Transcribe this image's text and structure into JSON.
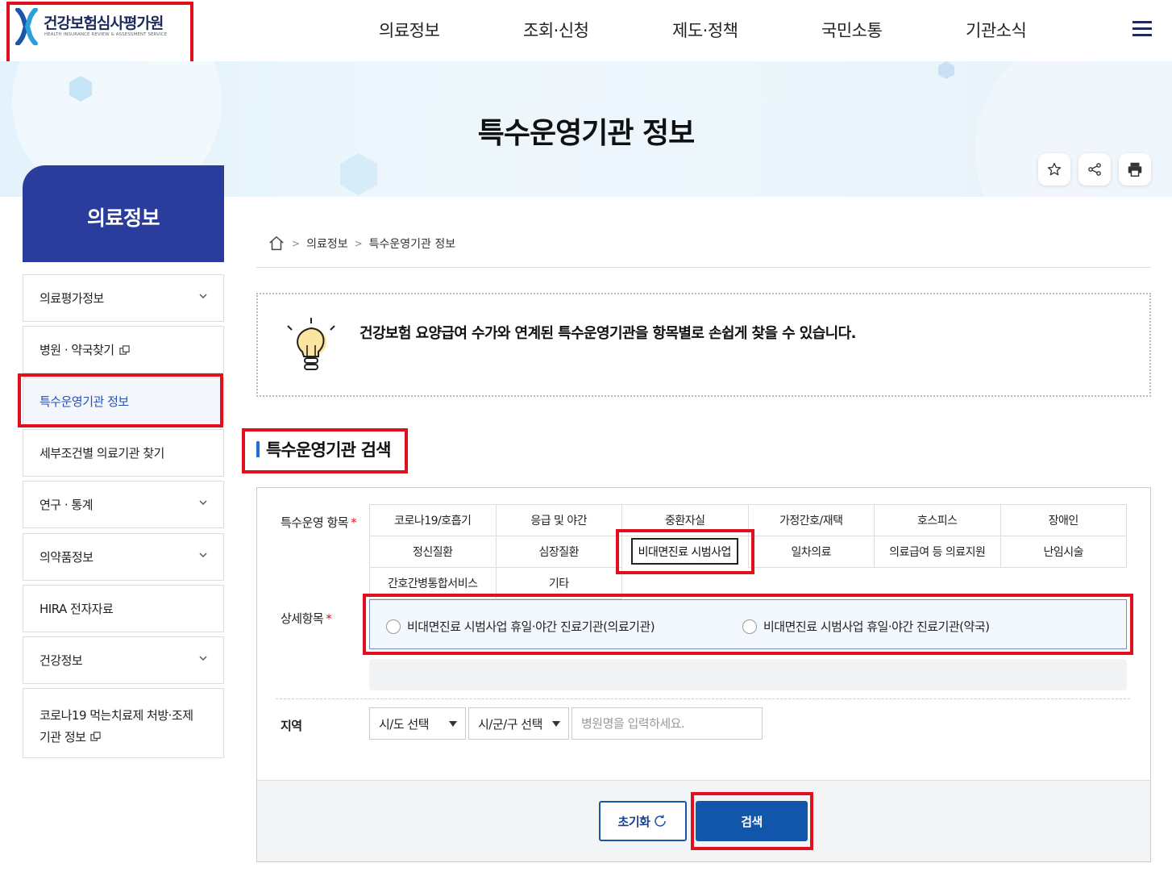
{
  "header": {
    "logo_ko": "건강보험심사평가원",
    "logo_en": "HEALTH INSURANCE REVIEW & ASSESSMENT SERVICE",
    "nav": [
      "의료정보",
      "조회·신청",
      "제도·정책",
      "국민소통",
      "기관소식"
    ],
    "menu_icon": "hamburger-icon"
  },
  "hero": {
    "title": "특수운영기관 정보",
    "utility_icons": [
      "star-icon",
      "share-icon",
      "print-icon"
    ]
  },
  "sidebar": {
    "title": "의료정보",
    "items": [
      {
        "label": "의료평가정보",
        "icon": "chevron-down-icon"
      },
      {
        "label": "병원 · 약국찾기",
        "icon": "external-link-icon"
      },
      {
        "label": "특수운영기관 정보",
        "active": true
      },
      {
        "label": "세부조건별 의료기관 찾기"
      },
      {
        "label": "연구 · 통계",
        "icon": "chevron-down-icon"
      },
      {
        "label": "의약품정보",
        "icon": "chevron-down-icon"
      },
      {
        "label": "HIRA 전자자료"
      },
      {
        "label": "건강정보",
        "icon": "chevron-down-icon"
      },
      {
        "label_line1": "코로나19 먹는치료제 처방·조제",
        "label_line2": "기관 정보",
        "icon": "external-link-icon"
      }
    ]
  },
  "breadcrumb": {
    "home_icon": "home-icon",
    "items": [
      "의료정보",
      "특수운영기관 정보"
    ]
  },
  "info": {
    "icon": "lightbulb-icon",
    "text": "건강보험 요양급여 수가와 연계된 특수운영기관을 항목별로 손쉽게 찾을 수 있습니다."
  },
  "search": {
    "section_title": "특수운영기관 검색",
    "category_label": "특수운영 항목",
    "required_mark": "*",
    "categories": [
      "코로나19/호흡기",
      "응급 및 야간",
      "중환자실",
      "가정간호/재택",
      "호스피스",
      "장애인",
      "정신질환",
      "심장질환",
      "비대면진료 시범사업",
      "일차의료",
      "의료급여 등 의료지원",
      "난임시술",
      "간호간병통합서비스",
      "기타"
    ],
    "selected_category": "비대면진료 시범사업",
    "detail_label": "상세항목",
    "detail_options": [
      "비대면진료 시범사업 휴일·야간 진료기관(의료기관)",
      "비대면진료 시범사업 휴일·야간 진료기관(약국)"
    ],
    "region_label": "지역",
    "sido_select": "시/도 선택",
    "sigungu_select": "시/군/구 선택",
    "hospital_placeholder": "병원명을 입력하세요.",
    "reset_label": "초기화",
    "search_label": "검색"
  },
  "colors": {
    "brand_navy": "#2a3d9c",
    "accent_blue": "#1156aa",
    "highlight_red": "#e0101f"
  }
}
